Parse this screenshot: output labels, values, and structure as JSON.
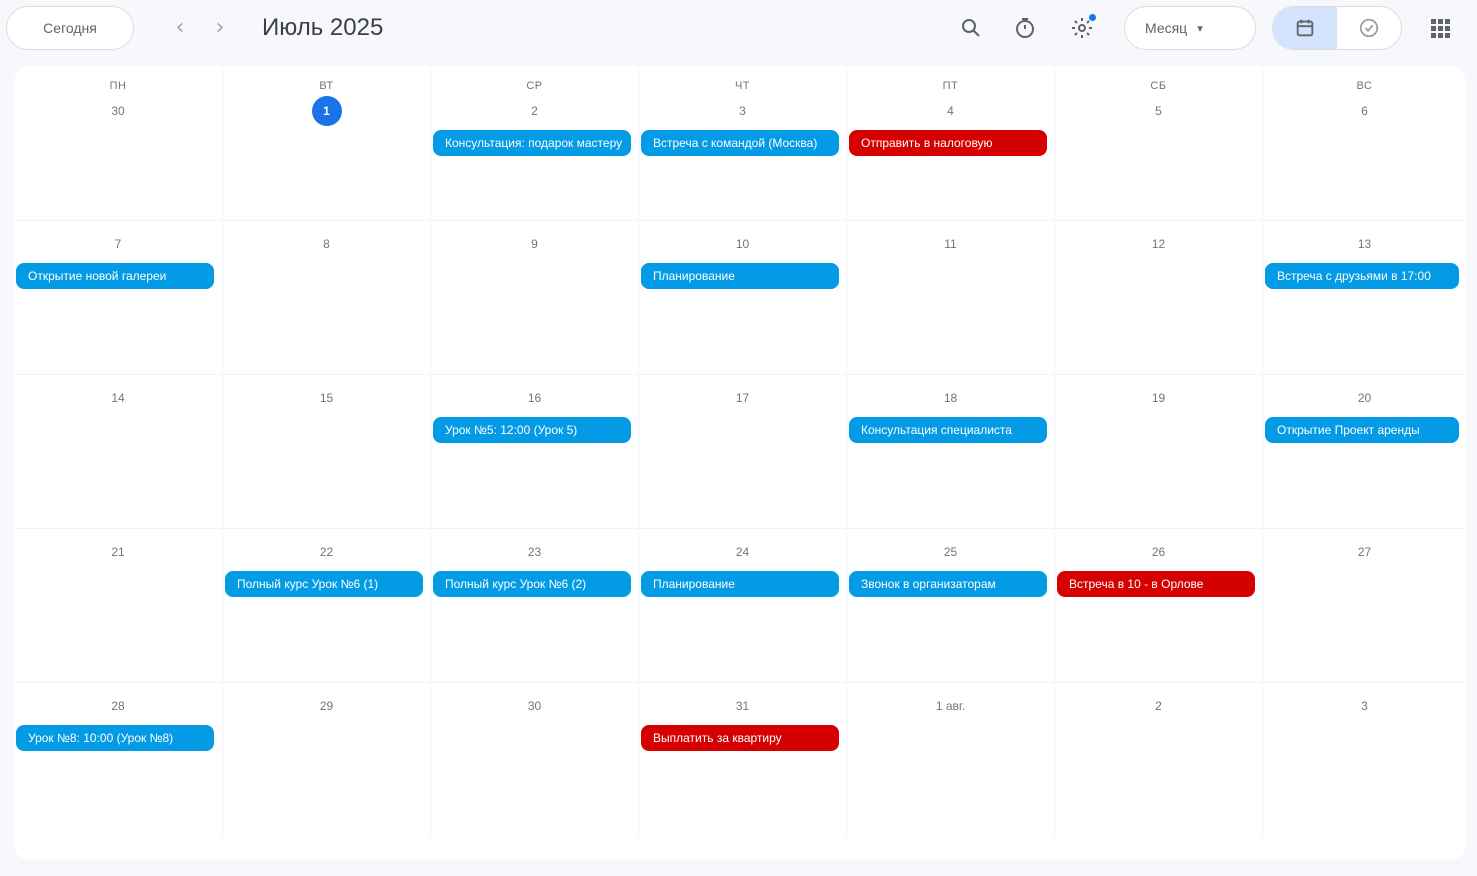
{
  "toolbar": {
    "today_label": "Сегодня",
    "prev_label": "‹",
    "next_label": "›",
    "month_title": "Июль 2025",
    "view_label": "Месяц",
    "view_caret": "▾"
  },
  "colors": {
    "accent": "#1a73e8",
    "event_blue": "#039be5",
    "event_red": "#d50000",
    "toggle_active": "#d3e3fd"
  },
  "icons": {
    "search": "search-icon",
    "timer": "timer-icon",
    "settings": "settings-icon",
    "calendar_view": "calendar-icon",
    "tasks_view": "check-circle-icon",
    "apps": "grid-icon"
  },
  "weekdays": [
    "ПН",
    "ВТ",
    "СР",
    "ЧТ",
    "ПТ",
    "СБ",
    "ВС"
  ],
  "weeks": [
    {
      "days": [
        {
          "label": "30",
          "today": false,
          "event": null
        },
        {
          "label": "1",
          "today": true,
          "event": null
        },
        {
          "label": "2",
          "today": false,
          "event": {
            "title": "Консультация: подарок мастеру",
            "color": "blue"
          }
        },
        {
          "label": "3",
          "today": false,
          "event": {
            "title": "Встреча с командой (Москва)",
            "color": "blue"
          }
        },
        {
          "label": "4",
          "today": false,
          "event": {
            "title": "Отправить в налоговую",
            "color": "red"
          }
        },
        {
          "label": "5",
          "today": false,
          "event": null
        },
        {
          "label": "6",
          "today": false,
          "event": null
        }
      ]
    },
    {
      "days": [
        {
          "label": "7",
          "today": false,
          "event": {
            "title": "Открытие новой галереи",
            "color": "blue"
          }
        },
        {
          "label": "8",
          "today": false,
          "event": null
        },
        {
          "label": "9",
          "today": false,
          "event": null
        },
        {
          "label": "10",
          "today": false,
          "event": {
            "title": "Планирование",
            "color": "blue"
          }
        },
        {
          "label": "11",
          "today": false,
          "event": null
        },
        {
          "label": "12",
          "today": false,
          "event": null
        },
        {
          "label": "13",
          "today": false,
          "event": {
            "title": "Встреча с друзьями в 17:00",
            "color": "blue"
          }
        }
      ]
    },
    {
      "days": [
        {
          "label": "14",
          "today": false,
          "event": null
        },
        {
          "label": "15",
          "today": false,
          "event": null
        },
        {
          "label": "16",
          "today": false,
          "event": {
            "title": "Урок №5: 12:00 (Урок 5)",
            "color": "blue"
          }
        },
        {
          "label": "17",
          "today": false,
          "event": null
        },
        {
          "label": "18",
          "today": false,
          "event": {
            "title": "Консультация специалиста",
            "color": "blue"
          }
        },
        {
          "label": "19",
          "today": false,
          "event": null
        },
        {
          "label": "20",
          "today": false,
          "event": {
            "title": "Открытие Проект аренды",
            "color": "blue"
          }
        }
      ]
    },
    {
      "days": [
        {
          "label": "21",
          "today": false,
          "event": null
        },
        {
          "label": "22",
          "today": false,
          "event": {
            "title": "Полный курс Урок №6 (1)",
            "color": "blue"
          }
        },
        {
          "label": "23",
          "today": false,
          "event": {
            "title": "Полный курс Урок №6 (2)",
            "color": "blue"
          }
        },
        {
          "label": "24",
          "today": false,
          "event": {
            "title": "Планирование",
            "color": "blue"
          }
        },
        {
          "label": "25",
          "today": false,
          "event": {
            "title": "Звонок в организаторам",
            "color": "blue"
          }
        },
        {
          "label": "26",
          "today": false,
          "event": {
            "title": "Встреча в 10 - в Орлове",
            "color": "red"
          }
        },
        {
          "label": "27",
          "today": false,
          "event": null
        }
      ]
    },
    {
      "days": [
        {
          "label": "28",
          "today": false,
          "event": {
            "title": "Урок №8: 10:00 (Урок №8)",
            "color": "blue"
          }
        },
        {
          "label": "29",
          "today": false,
          "event": null
        },
        {
          "label": "30",
          "today": false,
          "event": null
        },
        {
          "label": "31",
          "today": false,
          "event": {
            "title": "Выплатить за квартиру",
            "color": "red"
          }
        },
        {
          "label": "1 авг.",
          "today": false,
          "event": null
        },
        {
          "label": "2",
          "today": false,
          "event": null
        },
        {
          "label": "3",
          "today": false,
          "event": null
        }
      ]
    }
  ]
}
